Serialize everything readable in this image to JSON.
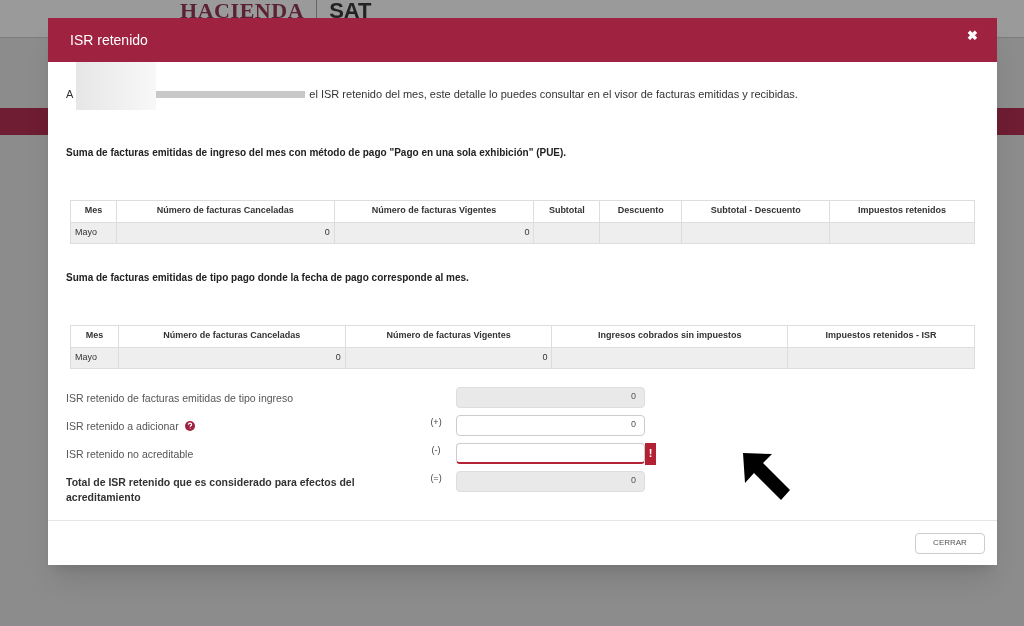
{
  "background": {
    "logo_text": "HACIENDA",
    "brand_text": "SAT"
  },
  "modal": {
    "title": "ISR retenido",
    "close_icon": "✖",
    "intro_start": "A",
    "intro_end": "el ISR retenido del mes, este detalle lo puedes consultar en el visor de facturas emitidas y recibidas."
  },
  "sections": [
    {
      "heading": "Suma de facturas emitidas de ingreso del mes con método de pago \"Pago en una sola exhibición\" (PUE).",
      "table": {
        "columns": [
          "Mes",
          "Número de facturas Canceladas",
          "Número de facturas Vigentes",
          "Subtotal",
          "Descuento",
          "Subtotal - Descuento",
          "Impuestos retenidos"
        ],
        "rows": [
          [
            "Mayo",
            "0",
            "0",
            "",
            "",
            "",
            ""
          ]
        ]
      }
    },
    {
      "heading": "Suma de facturas emitidas de tipo pago donde la fecha de pago corresponde al mes.",
      "table": {
        "columns": [
          "Mes",
          "Número de facturas Canceladas",
          "Número de facturas Vigentes",
          "Ingresos cobrados sin impuestos",
          "Impuestos retenidos - ISR"
        ],
        "rows": [
          [
            "Mayo",
            "0",
            "0",
            "",
            ""
          ]
        ]
      }
    }
  ],
  "fields": [
    {
      "label": "ISR retenido de facturas emitidas de tipo ingreso",
      "kind": "readonly",
      "value": "0",
      "help": false,
      "bold": false
    },
    {
      "label": "ISR retenido a adicionar",
      "kind": "input",
      "sign": "(+)",
      "value": "0",
      "help": true,
      "bold": false
    },
    {
      "label": "ISR retenido no acreditable",
      "kind": "error",
      "sign": "(-)",
      "error_mark": "!",
      "help": false,
      "bold": false
    },
    {
      "label": "Total de ISR retenido que es considerado para efectos del acreditamiento",
      "kind": "readonly",
      "sign": "(=)",
      "value": "0",
      "help": false,
      "bold": true
    }
  ],
  "footer": {
    "close_button": "CERRAR"
  }
}
